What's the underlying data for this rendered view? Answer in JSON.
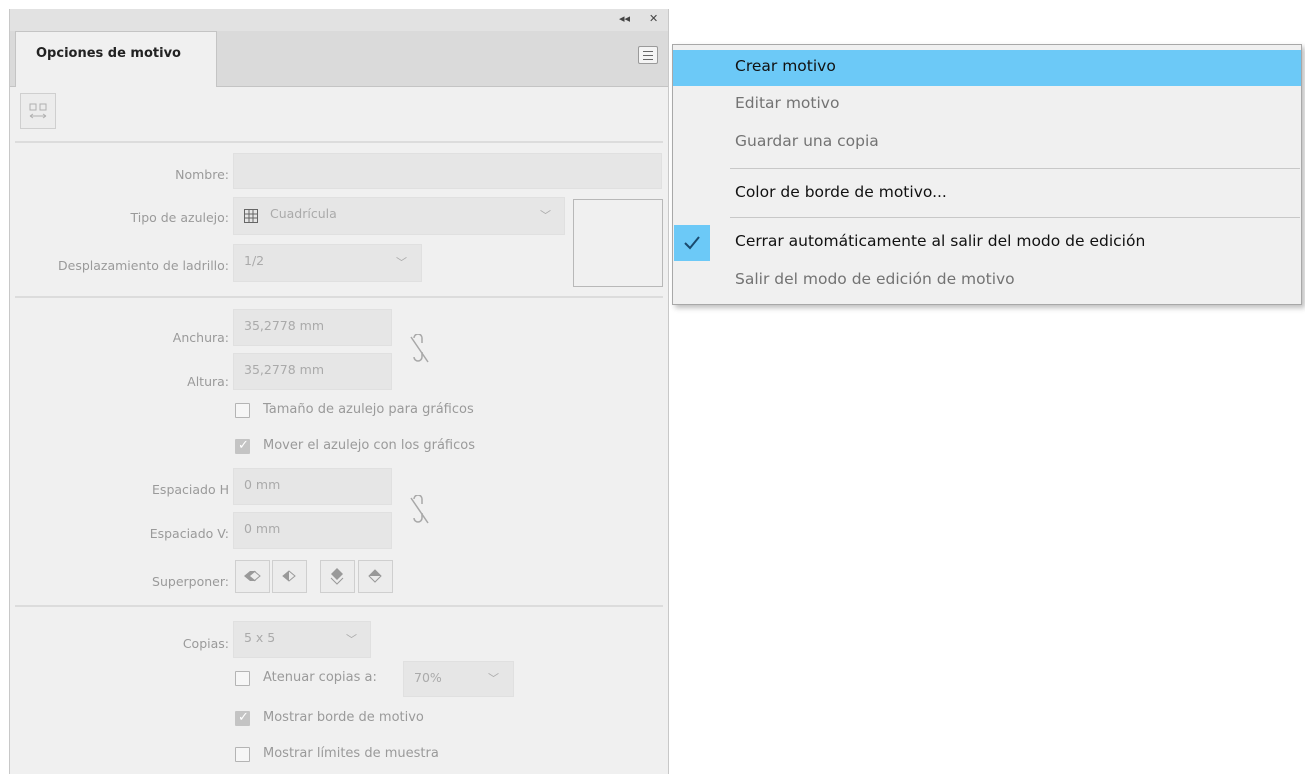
{
  "panel": {
    "titlebar": {
      "collapse_icon": "collapse-icon",
      "close_icon": "close-icon"
    },
    "tab_label": "Opciones de motivo",
    "menu_icon": "hamburger-menu-icon",
    "fit_tile_icon": "fit-tile-icon",
    "nombre": {
      "label": "Nombre:",
      "value": ""
    },
    "tipo_azulejo": {
      "label": "Tipo de azulejo:",
      "value": "Cuadrícula"
    },
    "desplazamiento": {
      "label": "Desplazamiento de ladrillo:",
      "value": "1/2"
    },
    "anchura": {
      "label": "Anchura:",
      "value": "35,2778 mm"
    },
    "altura": {
      "label": "Altura:",
      "value": "35,2778 mm"
    },
    "tamano_check": {
      "label": "Tamaño de azulejo para gráficos",
      "checked": false
    },
    "mover_check": {
      "label": "Mover el azulejo con los gráficos",
      "checked": true
    },
    "espaciado_h": {
      "label": "Espaciado H",
      "value": "0 mm"
    },
    "espaciado_v": {
      "label": "Espaciado V:",
      "value": "0 mm"
    },
    "superponer": {
      "label": "Superponer:"
    },
    "copias": {
      "label": "Copias:",
      "value": "5 x 5"
    },
    "atenuar_check": {
      "label": "Atenuar copias a:",
      "value": "70%",
      "checked": false
    },
    "mostrar_borde_check": {
      "label": "Mostrar borde de motivo",
      "checked": true
    },
    "mostrar_limites_check": {
      "label": "Mostrar límites de muestra",
      "checked": false
    }
  },
  "menu": {
    "items": [
      {
        "label": "Crear motivo",
        "state": "highlighted"
      },
      {
        "label": "Editar motivo",
        "state": "disabled"
      },
      {
        "label": "Guardar una copia",
        "state": "disabled"
      },
      {
        "label": "Color de borde de motivo...",
        "state": "enabled"
      },
      {
        "label": "Cerrar automáticamente al salir del modo de edición",
        "state": "enabled",
        "checked": true
      },
      {
        "label": "Salir del modo de edición de motivo",
        "state": "disabled"
      }
    ],
    "check_icon": "checkmark-icon",
    "highlight_color": "#6cc9f7"
  }
}
